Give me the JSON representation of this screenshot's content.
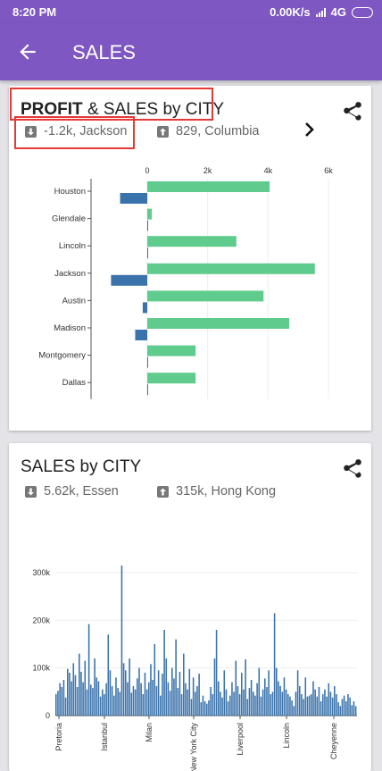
{
  "status_bar": {
    "time": "8:20 PM",
    "speed": "0.00K/s",
    "network": "4G"
  },
  "app_bar": {
    "title": "SALES"
  },
  "card_profit": {
    "title_bold": "PROFIT",
    "title_rest": " & SALES by CITY",
    "low_stat": "-1.2k, Jackson",
    "high_stat": "829, Columbia"
  },
  "card_sales": {
    "title": "SALES by CITY",
    "low_stat": "5.62k, Essen",
    "high_stat": "315k, Hong Kong"
  },
  "colors": {
    "purple": "#7e57c2",
    "profit": "#3a72ab",
    "sales": "#5fcb8c",
    "highlight": "#e53935"
  },
  "chart_data": [
    {
      "type": "bar",
      "orientation": "horizontal",
      "categories": [
        "Houston",
        "Glendale",
        "Lincoln",
        "Jackson",
        "Austin",
        "Madison",
        "Montgomery",
        "Dallas"
      ],
      "series": [
        {
          "name": "PROFIT",
          "values": [
            -900,
            20,
            20,
            -1200,
            -150,
            -400,
            20,
            20
          ]
        },
        {
          "name": "SALES",
          "values": [
            4050,
            150,
            2950,
            5550,
            3850,
            4700,
            1600,
            1600
          ]
        }
      ],
      "x_ticks": [
        "0",
        "2k",
        "4k",
        "6k"
      ],
      "xlim": [
        -1900,
        6100
      ]
    },
    {
      "type": "bar",
      "y_ticks": [
        "0",
        "100k",
        "200k",
        "300k"
      ],
      "ylim": [
        0,
        320000
      ],
      "x_labels": [
        "Pretoria",
        "Istanbul",
        "Milan",
        "New York City",
        "Liverpool",
        "Lincoln",
        "Cheyenne"
      ],
      "values": [
        45000,
        52000,
        68000,
        60000,
        75000,
        38000,
        98000,
        90000,
        72000,
        110000,
        85000,
        60000,
        130000,
        92000,
        70000,
        115000,
        55000,
        192000,
        65000,
        58000,
        120000,
        80000,
        72000,
        40000,
        55000,
        45000,
        68000,
        170000,
        95000,
        62000,
        42000,
        80000,
        58000,
        50000,
        315000,
        110000,
        95000,
        70000,
        120000,
        48000,
        62000,
        55000,
        78000,
        100000,
        68000,
        45000,
        90000,
        55000,
        70000,
        108000,
        75000,
        150000,
        62000,
        95000,
        42000,
        88000,
        180000,
        120000,
        70000,
        52000,
        100000,
        78000,
        160000,
        58000,
        92000,
        45000,
        130000,
        68000,
        55000,
        98000,
        35000,
        80000,
        50000,
        62000,
        88000,
        28000,
        42000,
        30000,
        25000,
        32000,
        60000,
        45000,
        120000,
        180000,
        72000,
        50000,
        38000,
        95000,
        55000,
        30000,
        42000,
        70000,
        50000,
        115000,
        62000,
        45000,
        90000,
        55000,
        118000,
        35000,
        58000,
        75000,
        50000,
        42000,
        68000,
        100000,
        40000,
        55000,
        78000,
        60000,
        95000,
        45000,
        50000,
        215000,
        100000,
        72000,
        62000,
        50000,
        80000,
        55000,
        45000,
        40000,
        32000,
        20000,
        50000,
        95000,
        62000,
        45000,
        35000,
        80000,
        40000,
        42000,
        45000,
        72000,
        55000,
        40000,
        60000,
        30000,
        45000,
        55000,
        40000,
        68000,
        50000,
        38000,
        62000,
        45000,
        28000,
        20000,
        35000,
        42000,
        30000,
        45000,
        38000,
        22000,
        30000,
        20000
      ]
    }
  ]
}
